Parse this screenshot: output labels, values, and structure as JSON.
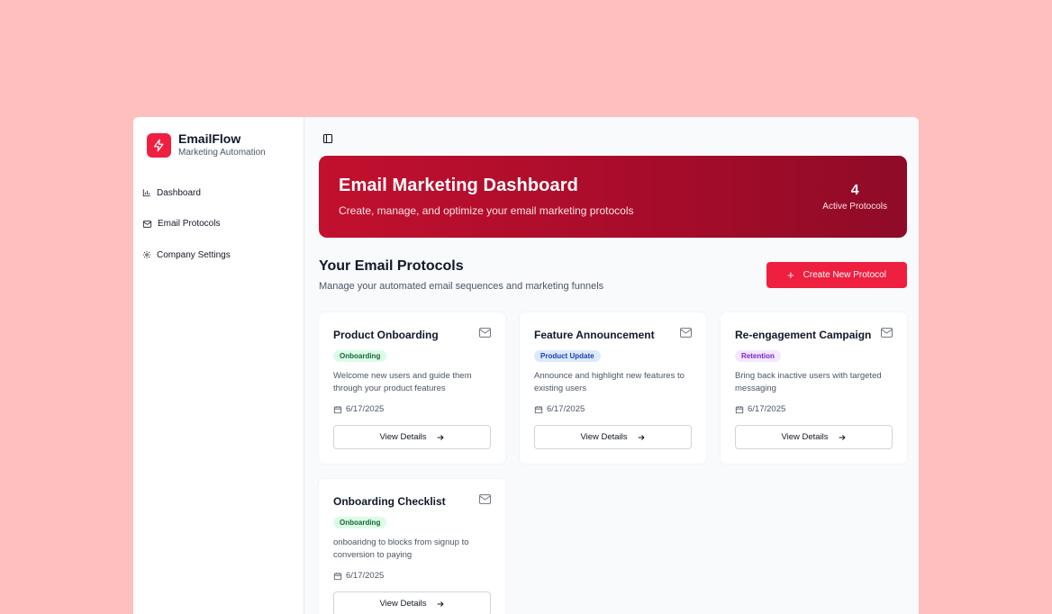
{
  "brand": {
    "name": "EmailFlow",
    "subtitle": "Marketing Automation"
  },
  "nav": [
    {
      "label": "Dashboard",
      "icon": "bar-chart-icon"
    },
    {
      "label": "Email Protocols",
      "icon": "mail-icon"
    },
    {
      "label": "Company Settings",
      "icon": "gear-icon"
    }
  ],
  "hero": {
    "title": "Email Marketing Dashboard",
    "subtitle": "Create, manage, and optimize your email marketing protocols",
    "count": "4",
    "count_label": "Active Protocols"
  },
  "section": {
    "title": "Your Email Protocols",
    "subtitle": "Manage your automated email sequences and marketing funnels",
    "create_label": "Create New Protocol"
  },
  "cards": [
    {
      "title": "Product Onboarding",
      "badge": "Onboarding",
      "desc": "Welcome new users and guide them through your product features",
      "date": "6/17/2025",
      "button": "View Details"
    },
    {
      "title": "Feature Announcement",
      "badge": "Product Update",
      "desc": "Announce and highlight new features to existing users",
      "date": "6/17/2025",
      "button": "View Details"
    },
    {
      "title": "Re-engagement Campaign",
      "badge": "Retention",
      "desc": "Bring back inactive users with targeted messaging",
      "date": "6/17/2025",
      "button": "View Details"
    },
    {
      "title": "Onboarding Checklist",
      "badge": "Onboarding",
      "desc": "onboaridng to blocks from signup to conversion to paying",
      "date": "6/17/2025",
      "button": "View Details"
    }
  ],
  "colors": {
    "brand": "#ef1f3f",
    "hero_start": "#c2102f",
    "hero_end": "#8f0b28",
    "background": "#ffbfbf"
  }
}
